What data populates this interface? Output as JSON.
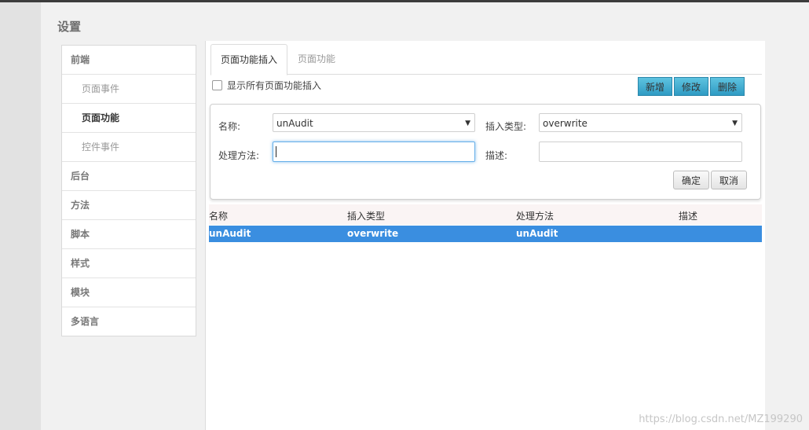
{
  "dialog": {
    "title": "设置"
  },
  "sidebar": {
    "items": [
      {
        "label": "前端",
        "type": "group"
      },
      {
        "label": "页面事件",
        "type": "sub"
      },
      {
        "label": "页面功能",
        "type": "sub",
        "active": true
      },
      {
        "label": "控件事件",
        "type": "sub"
      },
      {
        "label": "后台",
        "type": "group"
      },
      {
        "label": "方法",
        "type": "group"
      },
      {
        "label": "脚本",
        "type": "group"
      },
      {
        "label": "样式",
        "type": "group"
      },
      {
        "label": "模块",
        "type": "group"
      },
      {
        "label": "多语言",
        "type": "group"
      }
    ]
  },
  "tabs": [
    {
      "label": "页面功能插入",
      "active": true
    },
    {
      "label": "页面功能",
      "active": false
    }
  ],
  "show_all": {
    "label": "显示所有页面功能插入",
    "checked": false
  },
  "toolbar": {
    "add_label": "新增",
    "edit_label": "修改",
    "delete_label": "删除"
  },
  "form": {
    "name_label": "名称:",
    "name_value": "unAudit",
    "insert_type_label": "插入类型:",
    "insert_type_value": "overwrite",
    "method_label": "处理方法:",
    "method_value": "",
    "desc_label": "描述:",
    "desc_value": "",
    "confirm_label": "确定",
    "cancel_label": "取消"
  },
  "table": {
    "columns": [
      "名称",
      "插入类型",
      "处理方法",
      "描述"
    ],
    "rows": [
      {
        "name": "unAudit",
        "insert_type": "overwrite",
        "method": "unAudit",
        "desc": ""
      }
    ]
  },
  "watermark": "https://blog.csdn.net/MZ199290",
  "colors": {
    "accent": "#3a8ee0",
    "button_blue": "#2f9bc3"
  },
  "icons": {
    "dropdown": "chevron-down-icon"
  }
}
